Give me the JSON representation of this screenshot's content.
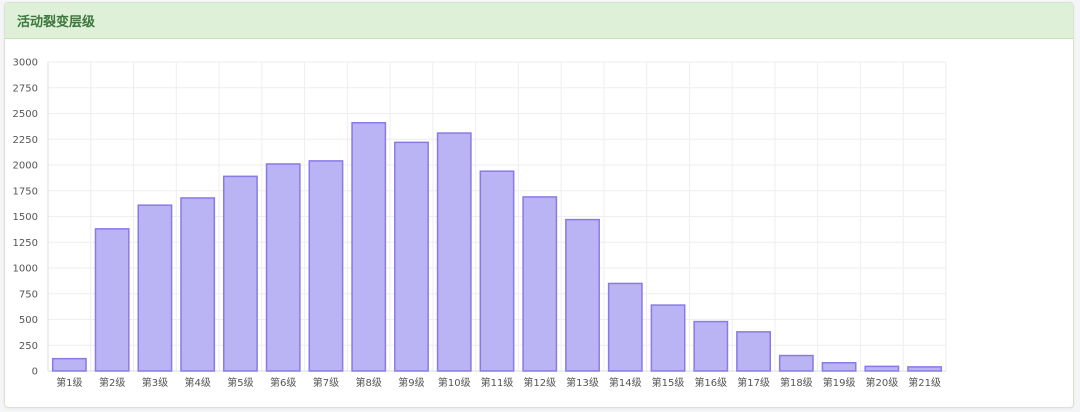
{
  "panel": {
    "title": "活动裂变层级"
  },
  "colors": {
    "header_bg": "#dff0d8",
    "title": "#3c763d",
    "bar_fill": "#bab3f4",
    "bar_stroke": "#8a7ae6",
    "grid": "#eeeeee"
  },
  "chart_data": {
    "type": "bar",
    "title": "",
    "xlabel": "",
    "ylabel": "",
    "ylim": [
      0,
      3000
    ],
    "yticks": [
      0,
      250,
      500,
      750,
      1000,
      1250,
      1500,
      1750,
      2000,
      2250,
      2500,
      2750,
      3000
    ],
    "grid": true,
    "legend": "none",
    "categories": [
      "第1级",
      "第2级",
      "第3级",
      "第4级",
      "第5级",
      "第6级",
      "第7级",
      "第8级",
      "第9级",
      "第10级",
      "第11级",
      "第12级",
      "第13级",
      "第14级",
      "第15级",
      "第16级",
      "第17级",
      "第18级",
      "第19级",
      "第20级",
      "第21级"
    ],
    "values": [
      120,
      1380,
      1610,
      1680,
      1890,
      2010,
      2040,
      2410,
      2220,
      2310,
      1940,
      1690,
      1470,
      850,
      640,
      480,
      380,
      150,
      80,
      45,
      40
    ]
  }
}
